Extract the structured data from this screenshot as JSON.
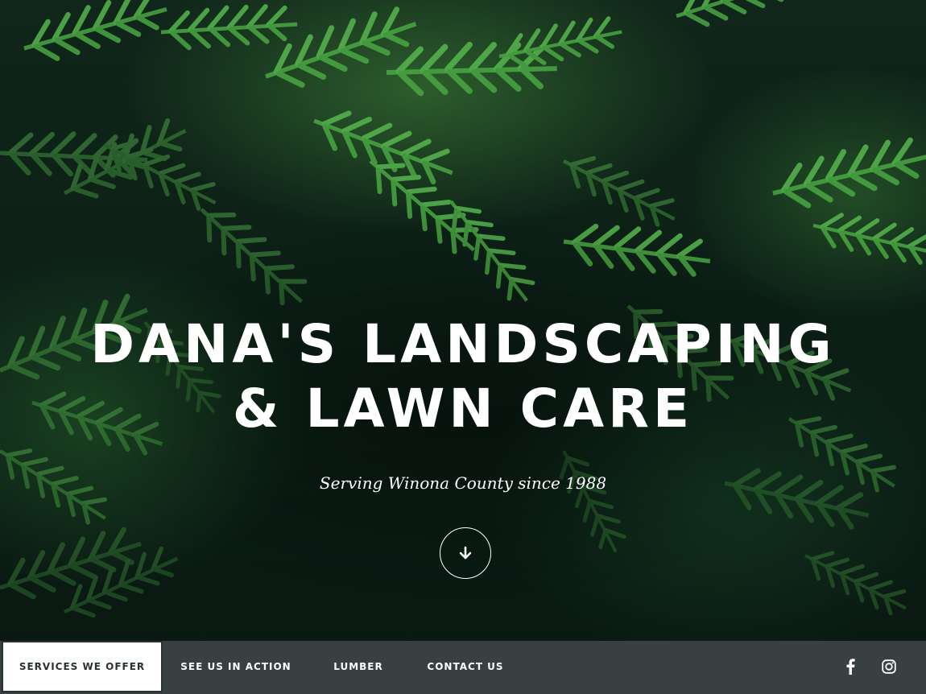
{
  "hero": {
    "title_line1": "DANA'S LANDSCAPING",
    "title_line2": "& LAWN CARE",
    "subtitle": "Serving Winona County since 1988",
    "scroll_icon": "arrow-down-icon",
    "overlay_color": "#0b1c14",
    "foliage_color": "#3f9a3a"
  },
  "nav": {
    "items": [
      {
        "label": "SERVICES WE OFFER",
        "active": true
      },
      {
        "label": "SEE US IN ACTION",
        "active": false
      },
      {
        "label": "LUMBER",
        "active": false
      },
      {
        "label": "CONTACT US",
        "active": false
      }
    ],
    "social": [
      {
        "icon": "facebook-icon"
      },
      {
        "icon": "instagram-icon"
      }
    ],
    "background": "#3a4244"
  }
}
